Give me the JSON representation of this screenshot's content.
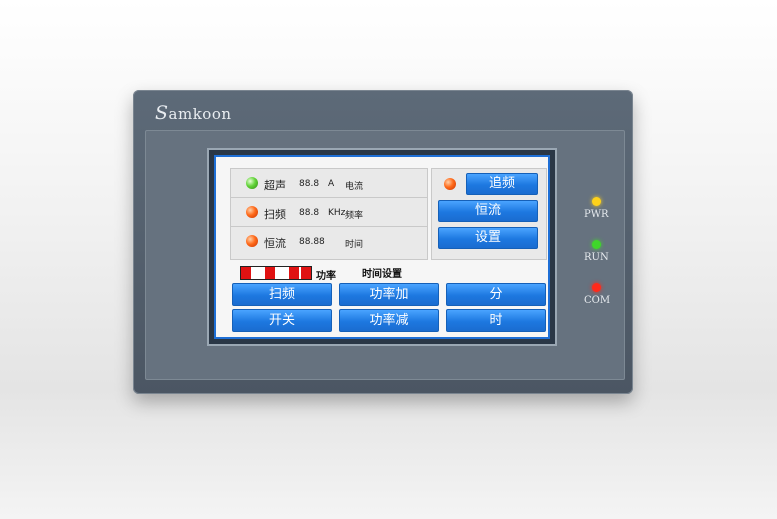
{
  "device": {
    "logo_cap": "S",
    "logo_rest": "amkoon"
  },
  "rows": [
    {
      "label": "超声",
      "value": "88.8",
      "unit": "A",
      "caption": "电流",
      "led_color": "green"
    },
    {
      "label": "扫频",
      "value": "88.8",
      "unit": "KHz",
      "caption": "频率",
      "led_color": "red"
    },
    {
      "label": "恒流",
      "value": "88.88",
      "unit": "",
      "caption": "时间",
      "led_color": "red"
    }
  ],
  "right_panel": {
    "track_label": "追频",
    "constant_label": "恒流",
    "settings_label": "设置",
    "led_color": "red"
  },
  "power": {
    "label": "功率",
    "segments_total": 6,
    "segments_on": [
      true,
      false,
      true,
      false,
      true,
      true
    ],
    "time_setting_label": "时间设置"
  },
  "buttons": {
    "sweep": "扫频",
    "power_up": "功率加",
    "minute": "分",
    "switch": "开关",
    "power_down": "功率减",
    "hour": "时"
  },
  "status": [
    {
      "label": "PWR",
      "color": "#ffd21a"
    },
    {
      "label": "RUN",
      "color": "#3fd62a"
    },
    {
      "label": "COM",
      "color": "#ff2a1a"
    }
  ],
  "colors": {
    "button_blue": "#1d78e0",
    "screen_border_blue": "#1e6fd6",
    "bezel": "#56626f"
  }
}
